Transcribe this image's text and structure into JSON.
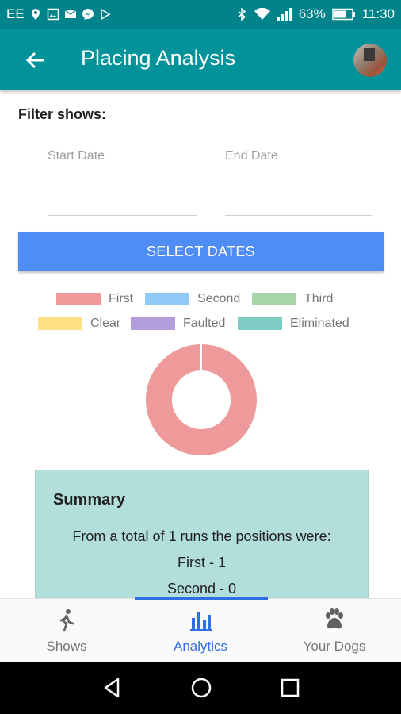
{
  "statusbar": {
    "carrier": "EE",
    "battery": "63%",
    "time": "11:30"
  },
  "appbar": {
    "title": "Placing Analysis",
    "back_icon": "arrow-left-icon",
    "avatar_icon": "profile-avatar"
  },
  "filter": {
    "label": "Filter shows:",
    "start_date": {
      "label": "Start Date",
      "value": ""
    },
    "end_date": {
      "label": "End Date",
      "value": ""
    },
    "button_label": "SELECT DATES",
    "button_color": "#4f8df5"
  },
  "chart_data": {
    "type": "pie",
    "donut": true,
    "categories": [
      "First",
      "Second",
      "Third",
      "Clear",
      "Faulted",
      "Eliminated"
    ],
    "values": [
      1,
      0,
      0,
      0,
      0,
      0
    ],
    "colors": [
      "#ef9a9a",
      "#90caf9",
      "#a5d6a7",
      "#ffe082",
      "#b39ddb",
      "#80cbc4"
    ],
    "legend_position": "top"
  },
  "summary": {
    "title": "Summary",
    "intro": "From a total of 1 runs the positions were:",
    "lines": [
      "First - 1",
      "Second - 0"
    ]
  },
  "bottom_nav": {
    "items": [
      {
        "label": "Shows",
        "icon": "walking-person-icon",
        "active": false
      },
      {
        "label": "Analytics",
        "icon": "bar-chart-icon",
        "active": true
      },
      {
        "label": "Your Dogs",
        "icon": "paw-icon",
        "active": false
      }
    ],
    "active_color": "#2f6fe6"
  }
}
